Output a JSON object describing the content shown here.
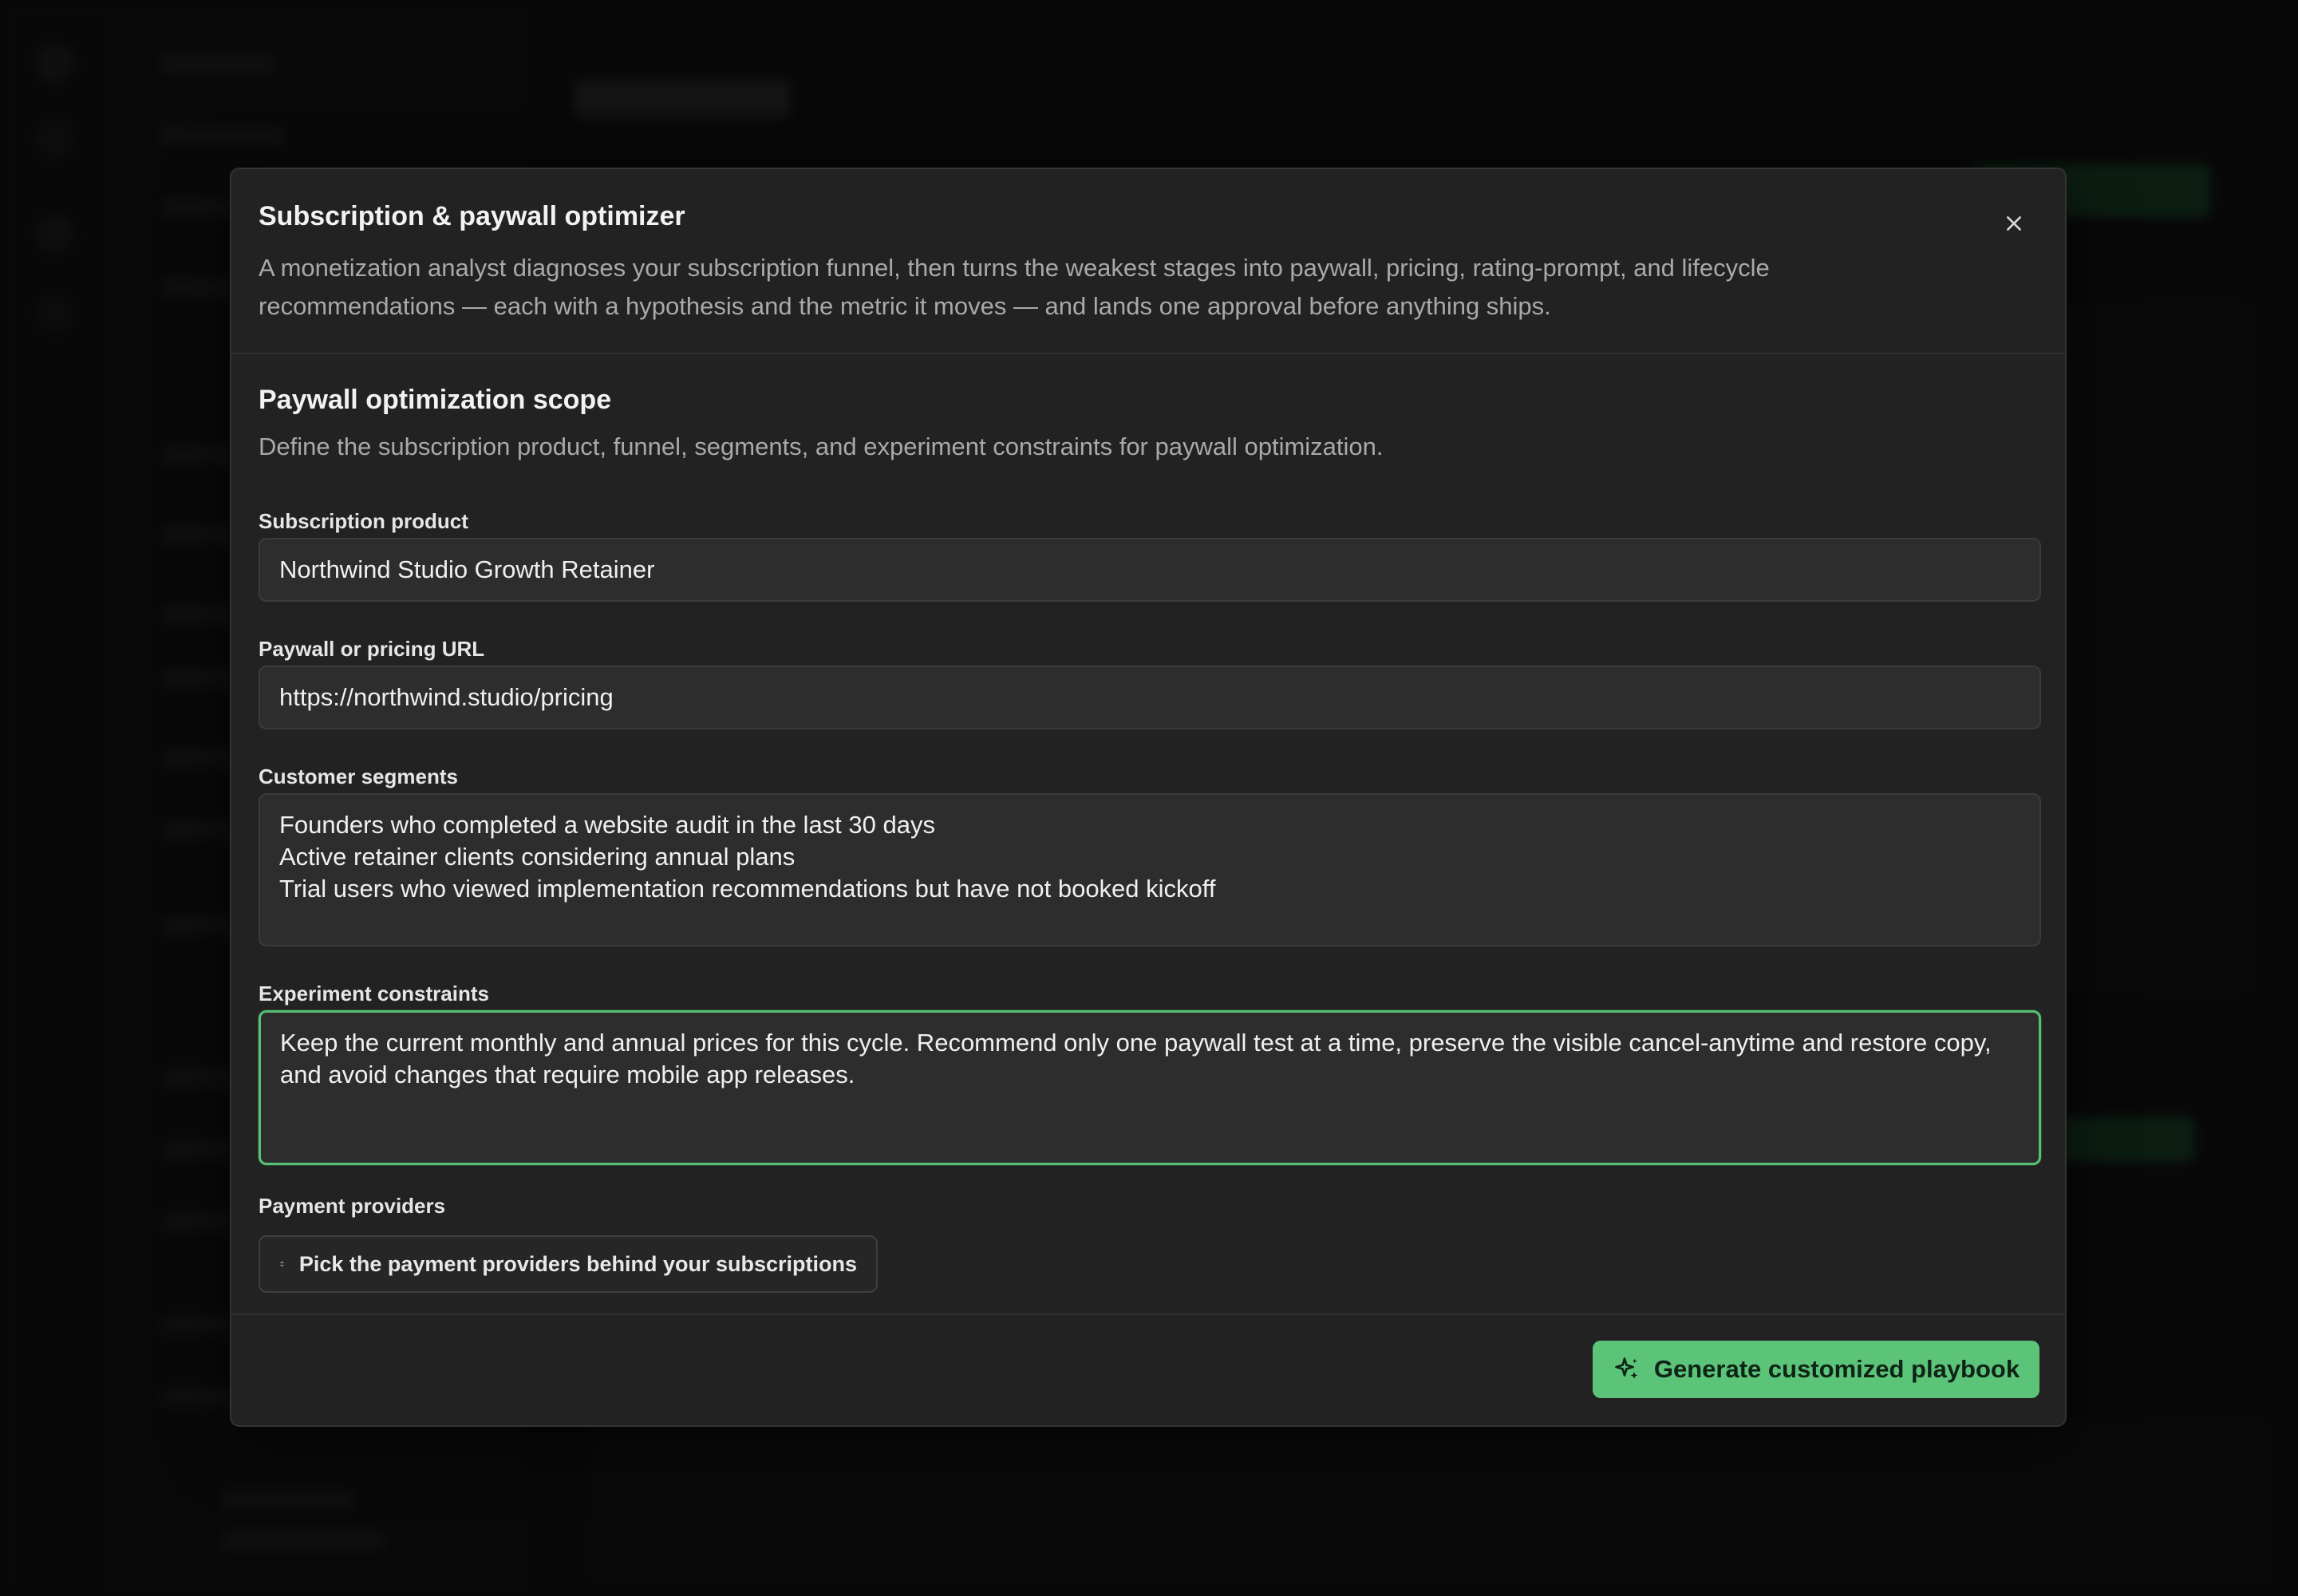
{
  "modal": {
    "title": "Subscription & paywall optimizer",
    "description": "A monetization analyst diagnoses your subscription funnel, then turns the weakest stages into paywall, pricing, rating-prompt, and lifecycle recommendations — each with a hypothesis and the metric it moves — and lands one approval before anything ships.",
    "close_icon": "close-icon"
  },
  "section": {
    "title": "Paywall optimization scope",
    "description": "Define the subscription product, funnel, segments, and experiment constraints for paywall optimization."
  },
  "fields": {
    "product": {
      "label": "Subscription product",
      "value": "Northwind Studio Growth Retainer"
    },
    "url": {
      "label": "Paywall or pricing URL",
      "value": "https://northwind.studio/pricing"
    },
    "segments": {
      "label": "Customer segments",
      "value": "Founders who completed a website audit in the last 30 days\nActive retainer clients considering annual plans\nTrial users who viewed implementation recommendations but have not booked kickoff"
    },
    "constraints": {
      "label": "Experiment constraints",
      "value": "Keep the current monthly and annual prices for this cycle. Recommend only one paywall test at a time, preserve the visible cancel-anytime and restore copy, and avoid changes that require mobile app releases."
    },
    "providers": {
      "label": "Payment providers",
      "picker_label": "Pick the payment providers behind your subscriptions",
      "icon": "chevron-up-down-icon"
    }
  },
  "footer": {
    "generate_label": "Generate customized playbook",
    "generate_icon": "sparkles-icon"
  },
  "colors": {
    "accent": "#5cc479",
    "focus_border": "#56c074",
    "modal_bg": "#222222"
  }
}
